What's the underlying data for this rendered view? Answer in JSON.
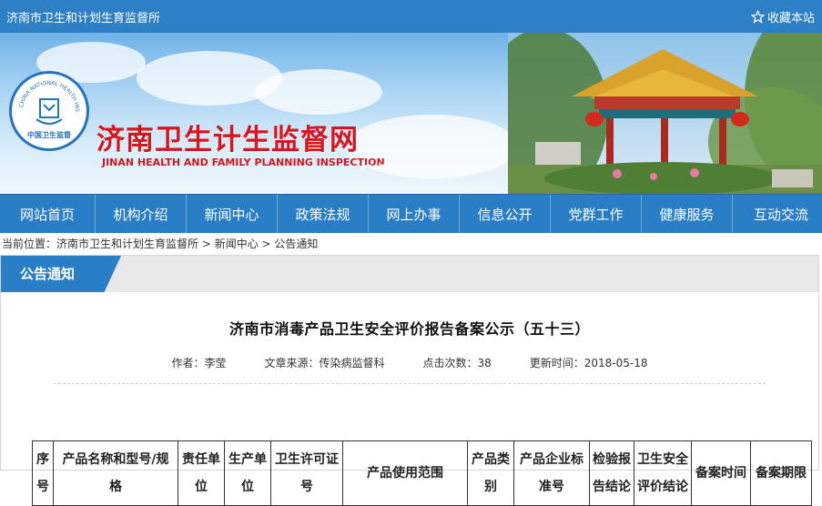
{
  "topbar": {
    "site_name": "济南市卫生和计划生育监督所",
    "favorite_label": "收藏本站"
  },
  "banner": {
    "seal_text_outer": "CHINA NATIONAL HEALTH INSPECTION",
    "seal_text_cn": "中国卫生监督",
    "title_cn": "济南卫生计生监督网",
    "title_en": "JINAN HEALTH AND FAMILY PLANNING INSPECTION"
  },
  "nav": {
    "items": [
      {
        "label": "网站首页"
      },
      {
        "label": "机构介绍"
      },
      {
        "label": "新闻中心"
      },
      {
        "label": "政策法规"
      },
      {
        "label": "网上办事"
      },
      {
        "label": "信息公开"
      },
      {
        "label": "党群工作"
      },
      {
        "label": "健康服务"
      },
      {
        "label": "互动交流"
      }
    ]
  },
  "breadcrumb": {
    "prefix": "当前位置：",
    "path": [
      "济南市卫生和计划生育监督所",
      "新闻中心",
      "公告通知"
    ],
    "separator": " > "
  },
  "panel": {
    "tab_label": "公告通知"
  },
  "article": {
    "title": "济南市消毒产品卫生安全评价报告备案公示（五十三）",
    "author": "作者：李莹",
    "source": "文章来源：传染病监督科",
    "views": "点击次数：38",
    "updated": "更新时间：2018-05-18"
  },
  "table": {
    "headers": [
      {
        "line1": "序",
        "line2": "号"
      },
      {
        "line1": "产品名称和型号/规",
        "line2": "格"
      },
      {
        "line1": "责任单",
        "line2": "位"
      },
      {
        "line1": "生产单",
        "line2": "位"
      },
      {
        "line1": "卫生许可证",
        "line2": "号"
      },
      {
        "line1": "产品使用范围",
        "line2": ""
      },
      {
        "line1": "产品类",
        "line2": "别"
      },
      {
        "line1": "产品企业标",
        "line2": "准号"
      },
      {
        "line1": "检验报",
        "line2": "告结论"
      },
      {
        "line1": "卫生安全",
        "line2": "评价结论"
      },
      {
        "line1": "备案时间",
        "line2": ""
      },
      {
        "line1": "备案期限",
        "line2": ""
      }
    ]
  },
  "colors": {
    "primary_blue": "#2a7ec5",
    "title_red": "#d6151f"
  }
}
